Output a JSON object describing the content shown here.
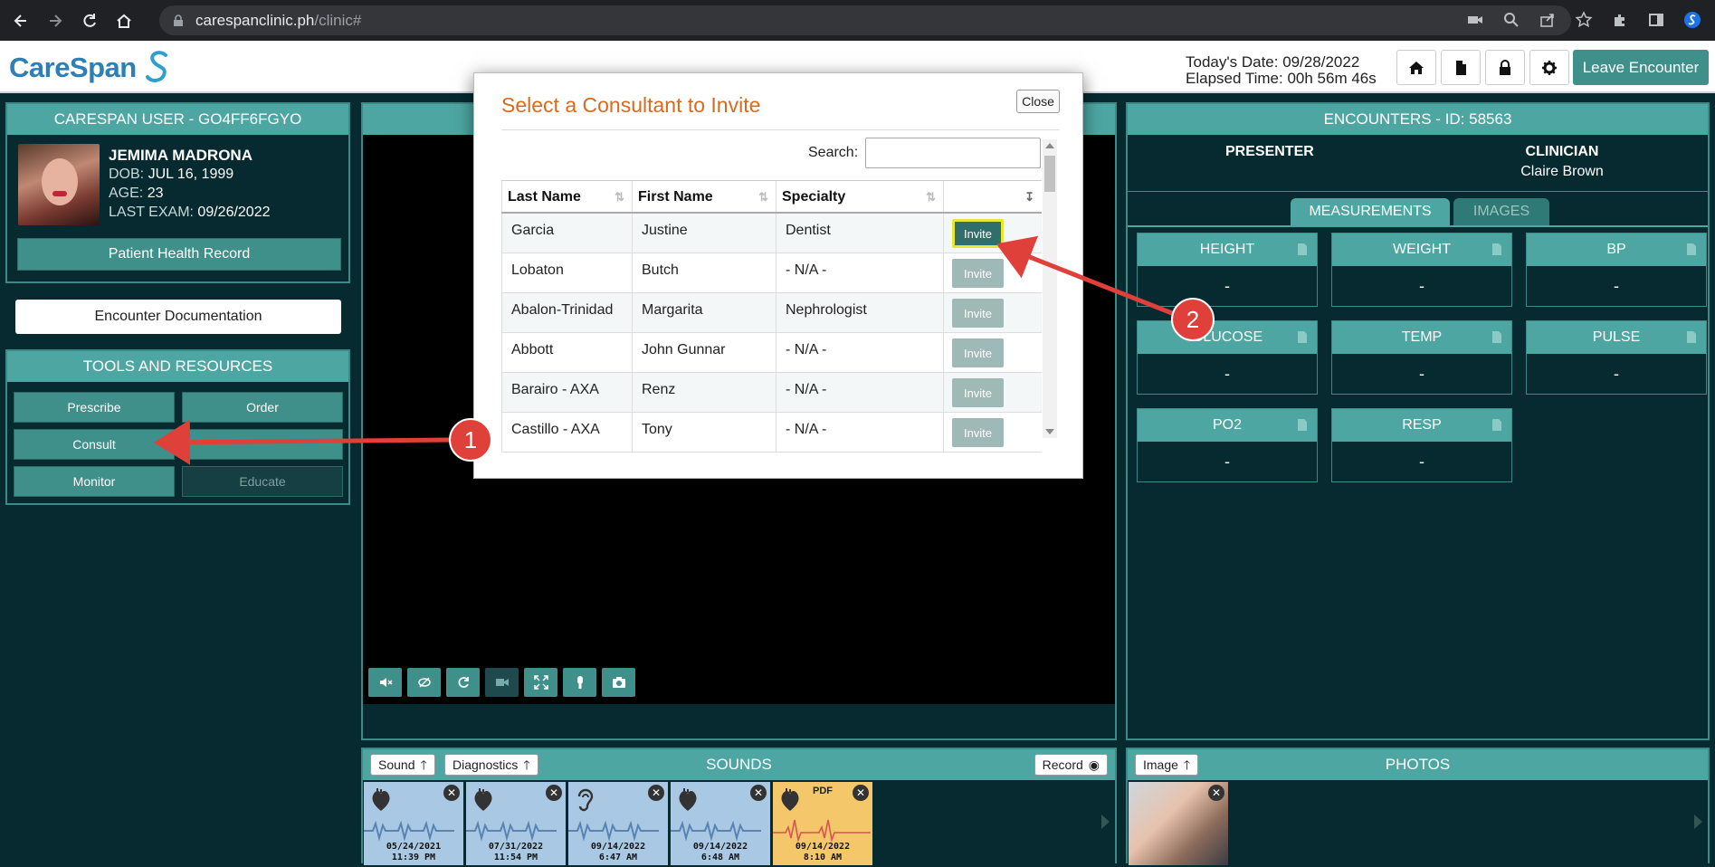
{
  "browser": {
    "url_host": "carespanclinic.ph",
    "url_path": "/clinic#"
  },
  "header": {
    "brand": "CareSpan",
    "todays_date_label": "Today's Date:",
    "todays_date": "09/28/2022",
    "elapsed_label": "Elapsed Time:",
    "elapsed": "00h 56m 46s",
    "leave_label": "Leave Encounter"
  },
  "patient_panel": {
    "title": "CARESPAN USER - GO4FF6FGYO",
    "name": "JEMIMA MADRONA",
    "dob_label": "DOB:",
    "dob": "JUL 16, 1999",
    "age_label": "AGE:",
    "age": "23",
    "last_exam_label": "LAST EXAM:",
    "last_exam": "09/26/2022",
    "phr_label": "Patient Health Record"
  },
  "encounter_doc_label": "Encounter Documentation",
  "tools": {
    "title": "TOOLS AND RESOURCES",
    "prescribe": "Prescribe",
    "order": "Order",
    "consult": "Consult",
    "monitor": "Monitor",
    "educate": "Educate"
  },
  "encounters": {
    "title": "ENCOUNTERS - ID: 58563",
    "presenter_label": "PRESENTER",
    "clinician_label": "CLINICIAN",
    "clinician_name": "Claire Brown",
    "tab_measurements": "MEASUREMENTS",
    "tab_images": "IMAGES",
    "measurements": [
      {
        "label": "HEIGHT",
        "value": "-"
      },
      {
        "label": "WEIGHT",
        "value": "-"
      },
      {
        "label": "BP",
        "value": "-"
      },
      {
        "label": "GLUCOSE",
        "value": "-"
      },
      {
        "label": "TEMP",
        "value": "-"
      },
      {
        "label": "PULSE",
        "value": "-"
      },
      {
        "label": "PO2",
        "value": "-"
      },
      {
        "label": "RESP",
        "value": "-"
      }
    ]
  },
  "sounds": {
    "title": "SOUNDS",
    "sound_btn": "Sound",
    "diagnostics_btn": "Diagnostics",
    "record_btn": "Record",
    "items": [
      {
        "date": "05/24/2021",
        "time": "11:39 PM",
        "kind": "heart-icon"
      },
      {
        "date": "07/31/2022",
        "time": "11:54 PM",
        "kind": "heart-icon"
      },
      {
        "date": "09/14/2022",
        "time": "6:47 AM",
        "kind": "ear-icon"
      },
      {
        "date": "09/14/2022",
        "time": "6:48 AM",
        "kind": "heart-icon"
      },
      {
        "date": "09/14/2022",
        "time": "8:10 AM",
        "kind": "heart-icon",
        "pdf": "PDF"
      }
    ]
  },
  "photos": {
    "title": "PHOTOS",
    "image_btn": "Image"
  },
  "modal": {
    "title": "Select a Consultant to Invite",
    "close_label": "Close",
    "search_label": "Search:",
    "search_value": "",
    "columns": [
      "Last Name",
      "First Name",
      "Specialty",
      ""
    ],
    "invite_label": "Invite",
    "rows": [
      {
        "last": "Garcia",
        "first": "Justine",
        "specialty": "Dentist"
      },
      {
        "last": "Lobaton",
        "first": "Butch",
        "specialty": "- N/A -"
      },
      {
        "last": "Abalon-Trinidad",
        "first": "Margarita",
        "specialty": "Nephrologist"
      },
      {
        "last": "Abbott",
        "first": "John Gunnar",
        "specialty": "- N/A -"
      },
      {
        "last": "Barairo - AXA",
        "first": "Renz",
        "specialty": "- N/A -"
      },
      {
        "last": "Castillo - AXA",
        "first": "Tony",
        "specialty": "- N/A -"
      }
    ]
  },
  "annotations": {
    "marker_1": "1",
    "marker_2": "2",
    "color": "#e0403a"
  },
  "colors": {
    "teal": "#4da6a2",
    "teal_button": "#3f8f8a",
    "background": "#062a30",
    "modal_title": "#d96a1e"
  }
}
